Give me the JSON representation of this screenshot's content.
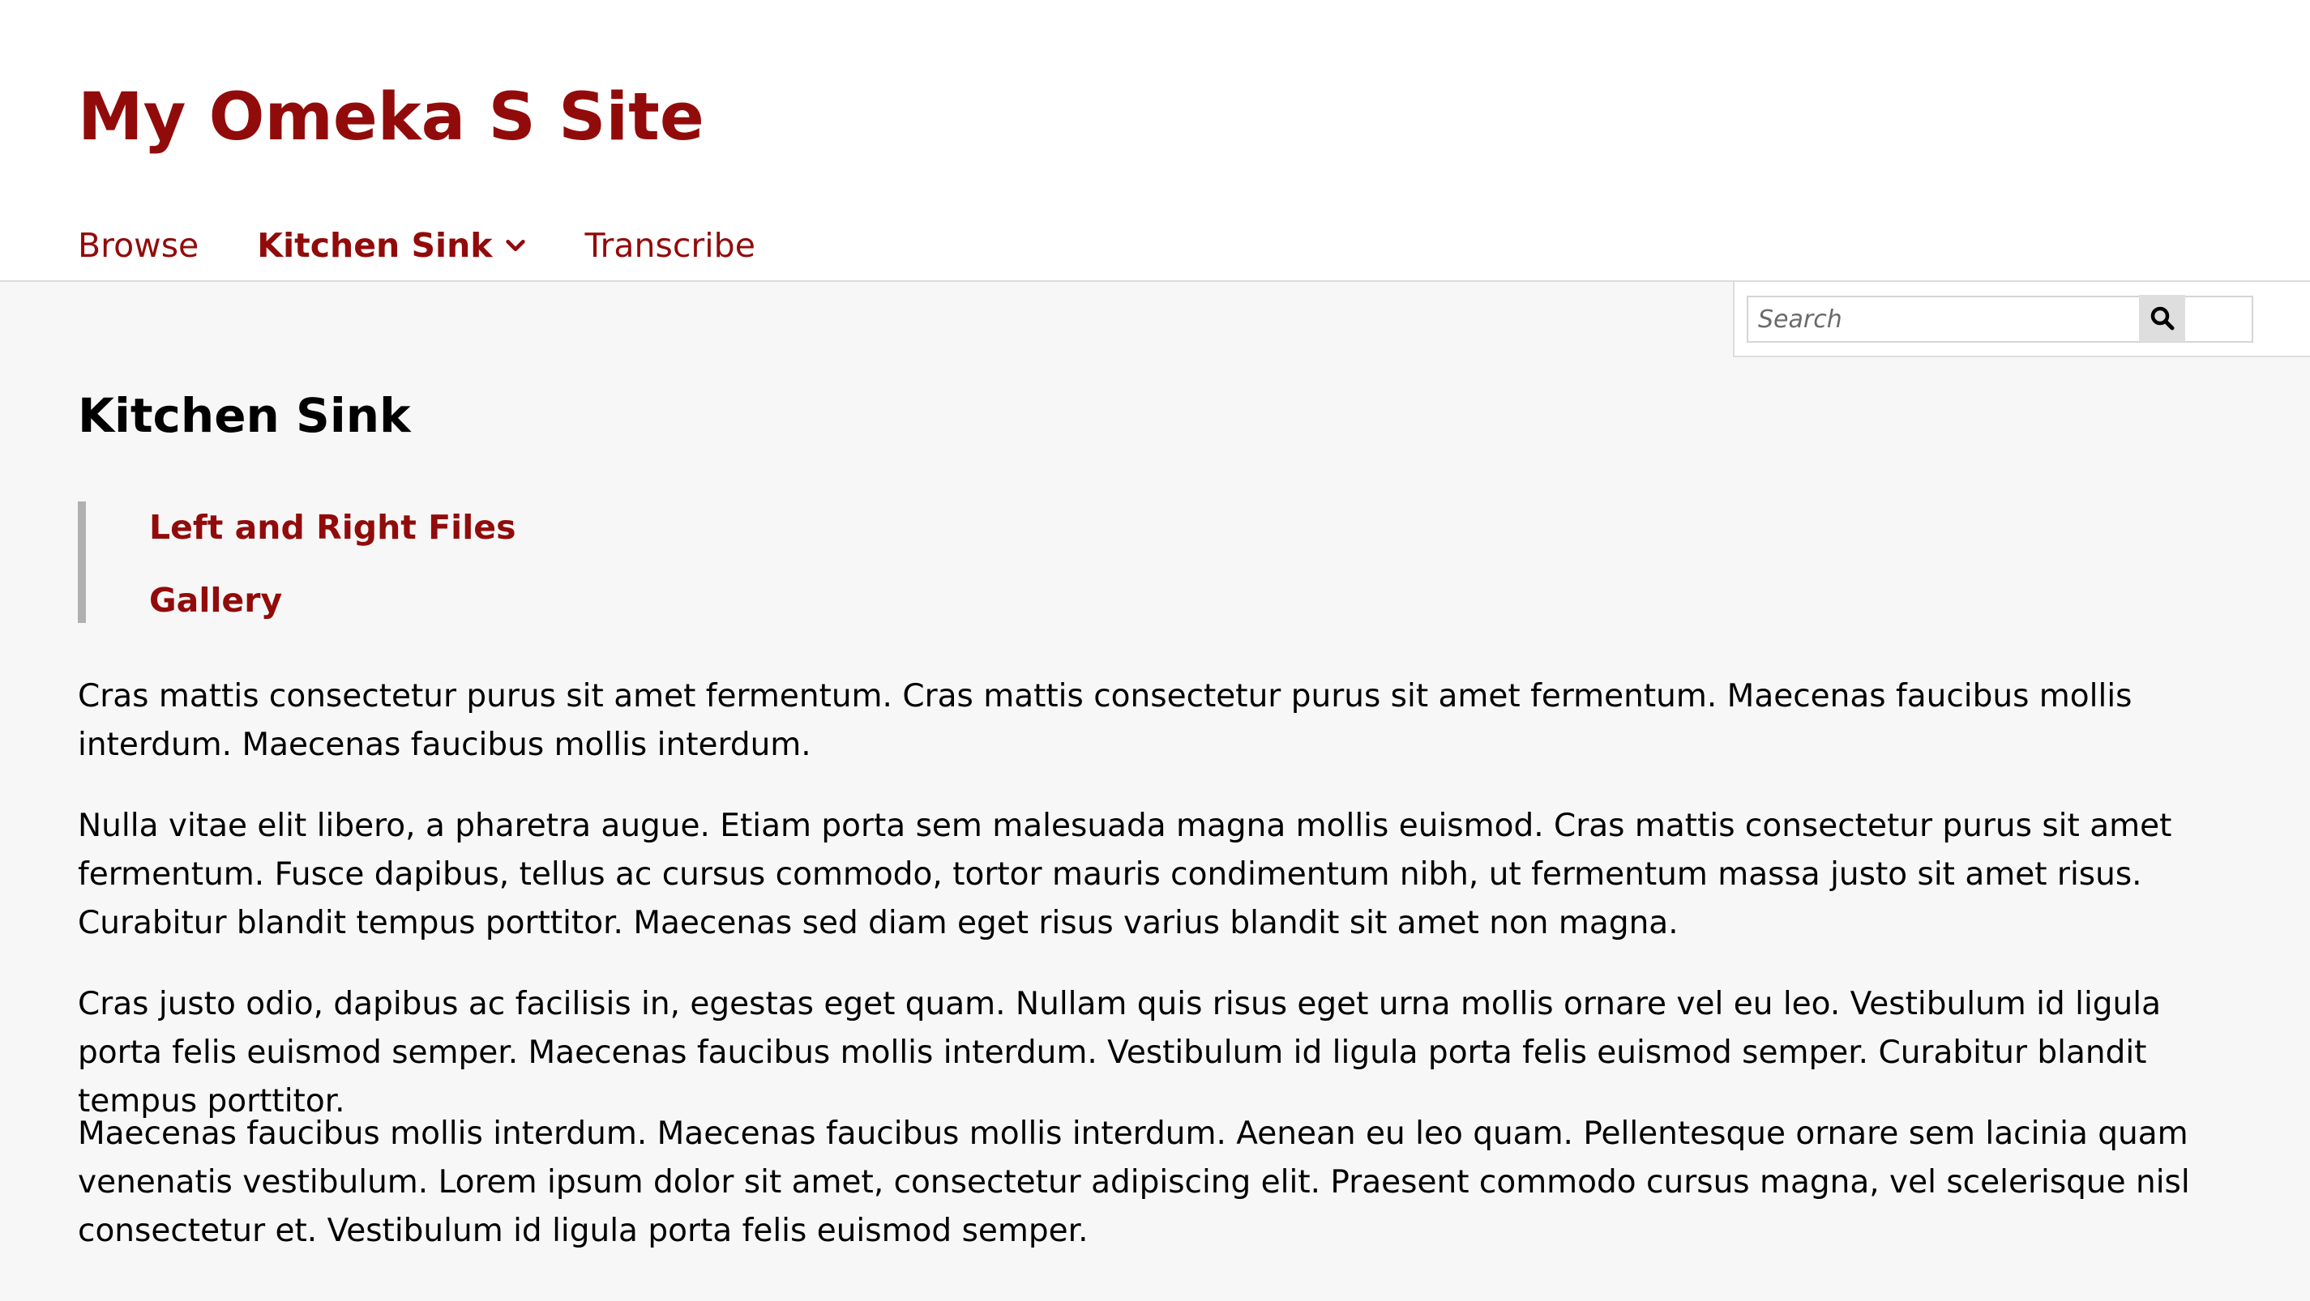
{
  "site": {
    "title": "My Omeka S Site"
  },
  "nav": {
    "items": [
      {
        "label": "Browse",
        "active": false
      },
      {
        "label": "Kitchen Sink",
        "active": true,
        "has_dropdown": true
      },
      {
        "label": "Transcribe",
        "active": false
      }
    ]
  },
  "search": {
    "placeholder": "Search",
    "value": "",
    "button_icon": "search-icon"
  },
  "page": {
    "title": "Kitchen Sink",
    "subpages": [
      {
        "label": "Left and Right Files"
      },
      {
        "label": "Gallery"
      }
    ],
    "paragraphs": [
      "Cras mattis consectetur purus sit amet fermentum. Cras mattis consectetur purus sit amet fermentum. Maecenas faucibus mollis interdum. Maecenas faucibus mollis interdum.",
      "Nulla vitae elit libero, a pharetra augue. Etiam porta sem malesuada magna mollis euismod. Cras mattis consectetur purus sit amet fermentum. Fusce dapibus, tellus ac cursus commodo, tortor mauris condimentum nibh, ut fermentum massa justo sit amet risus. Curabitur blandit tempus porttitor. Maecenas sed diam eget risus varius blandit sit amet non magna.",
      "Cras justo odio, dapibus ac facilisis in, egestas eget quam. Nullam quis risus eget urna mollis ornare vel eu leo. Vestibulum id ligula porta felis euismod semper. Maecenas faucibus mollis interdum. Vestibulum id ligula porta felis euismod semper. Curabitur blandit tempus porttitor.",
      "Maecenas faucibus mollis interdum. Maecenas faucibus mollis interdum. Aenean eu leo quam. Pellentesque ornare sem lacinia quam venenatis vestibulum. Lorem ipsum dolor sit amet, consectetur adipiscing elit. Praesent commodo cursus magna, vel scelerisque nisl consectetur et. Vestibulum id ligula porta felis euismod semper."
    ]
  },
  "colors": {
    "accent": "#920b0b",
    "page_background": "#f7f7f7",
    "header_background": "#ffffff",
    "text": "#000000"
  }
}
